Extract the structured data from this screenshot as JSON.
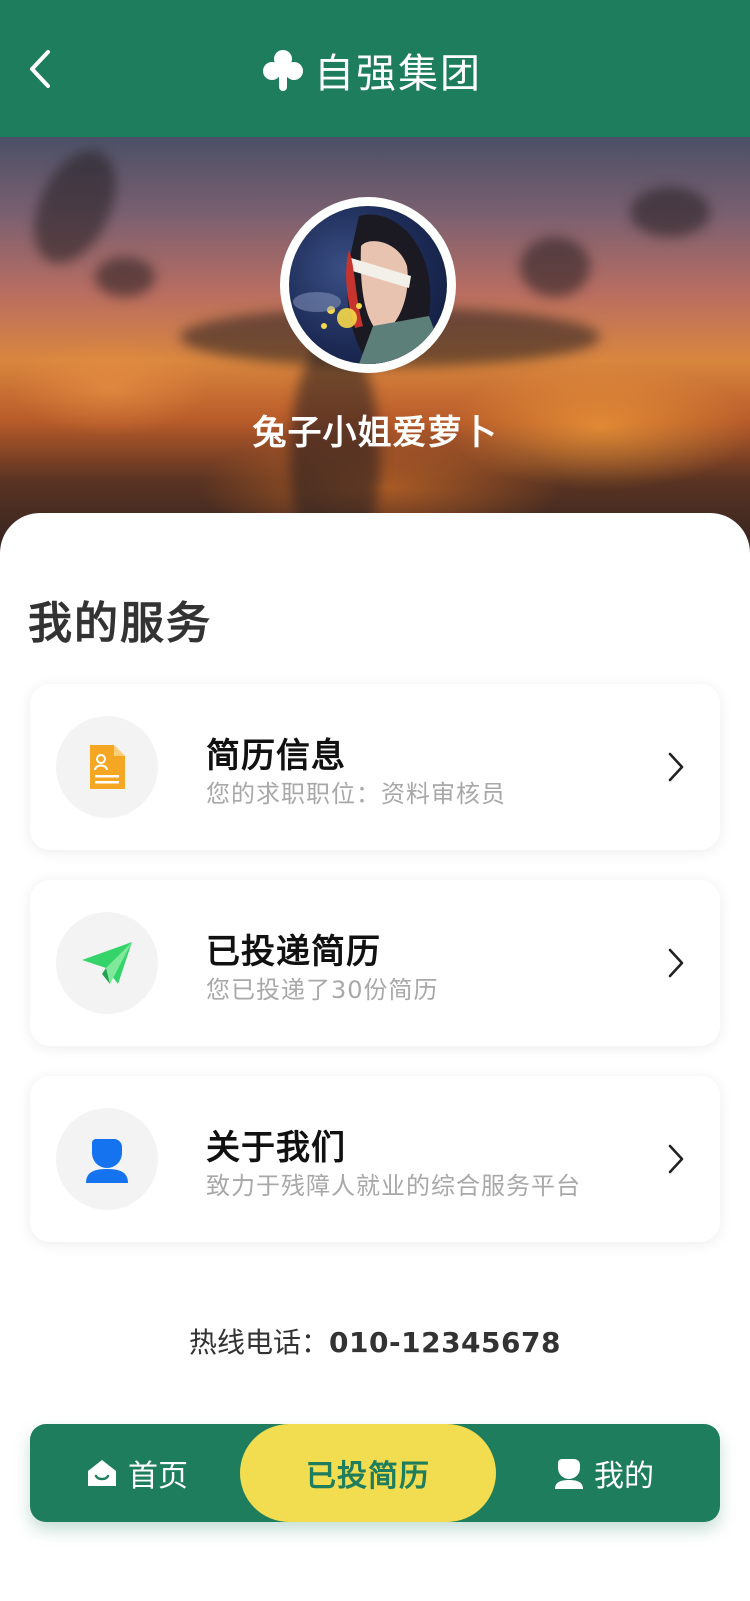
{
  "header": {
    "brand_name": "自强集团",
    "icons": {
      "back": "chevron-left-icon",
      "logo": "clover-logo-icon"
    }
  },
  "profile": {
    "username": "兔子小姐爱萝卜"
  },
  "services": {
    "title": "我的服务",
    "items": [
      {
        "title": "简历信息",
        "subtitle": "您的求职职位：资料审核员",
        "icon": "resume-document-icon"
      },
      {
        "title": "已投递简历",
        "subtitle": "您已投递了30份简历",
        "icon": "paper-plane-icon"
      },
      {
        "title": "关于我们",
        "subtitle": "致力于残障人就业的综合服务平台",
        "icon": "user-icon"
      }
    ]
  },
  "hotline": {
    "label": "热线电话：",
    "number": "010-12345678"
  },
  "bottom_nav": {
    "home": "首页",
    "center": "已投简历",
    "mine": "我的"
  },
  "colors": {
    "brand_green": "#1e7d5c",
    "accent_yellow": "#f2dc4f",
    "resume_orange": "#f5a623",
    "plane_green": "#35d46a",
    "user_blue": "#1673f0"
  }
}
